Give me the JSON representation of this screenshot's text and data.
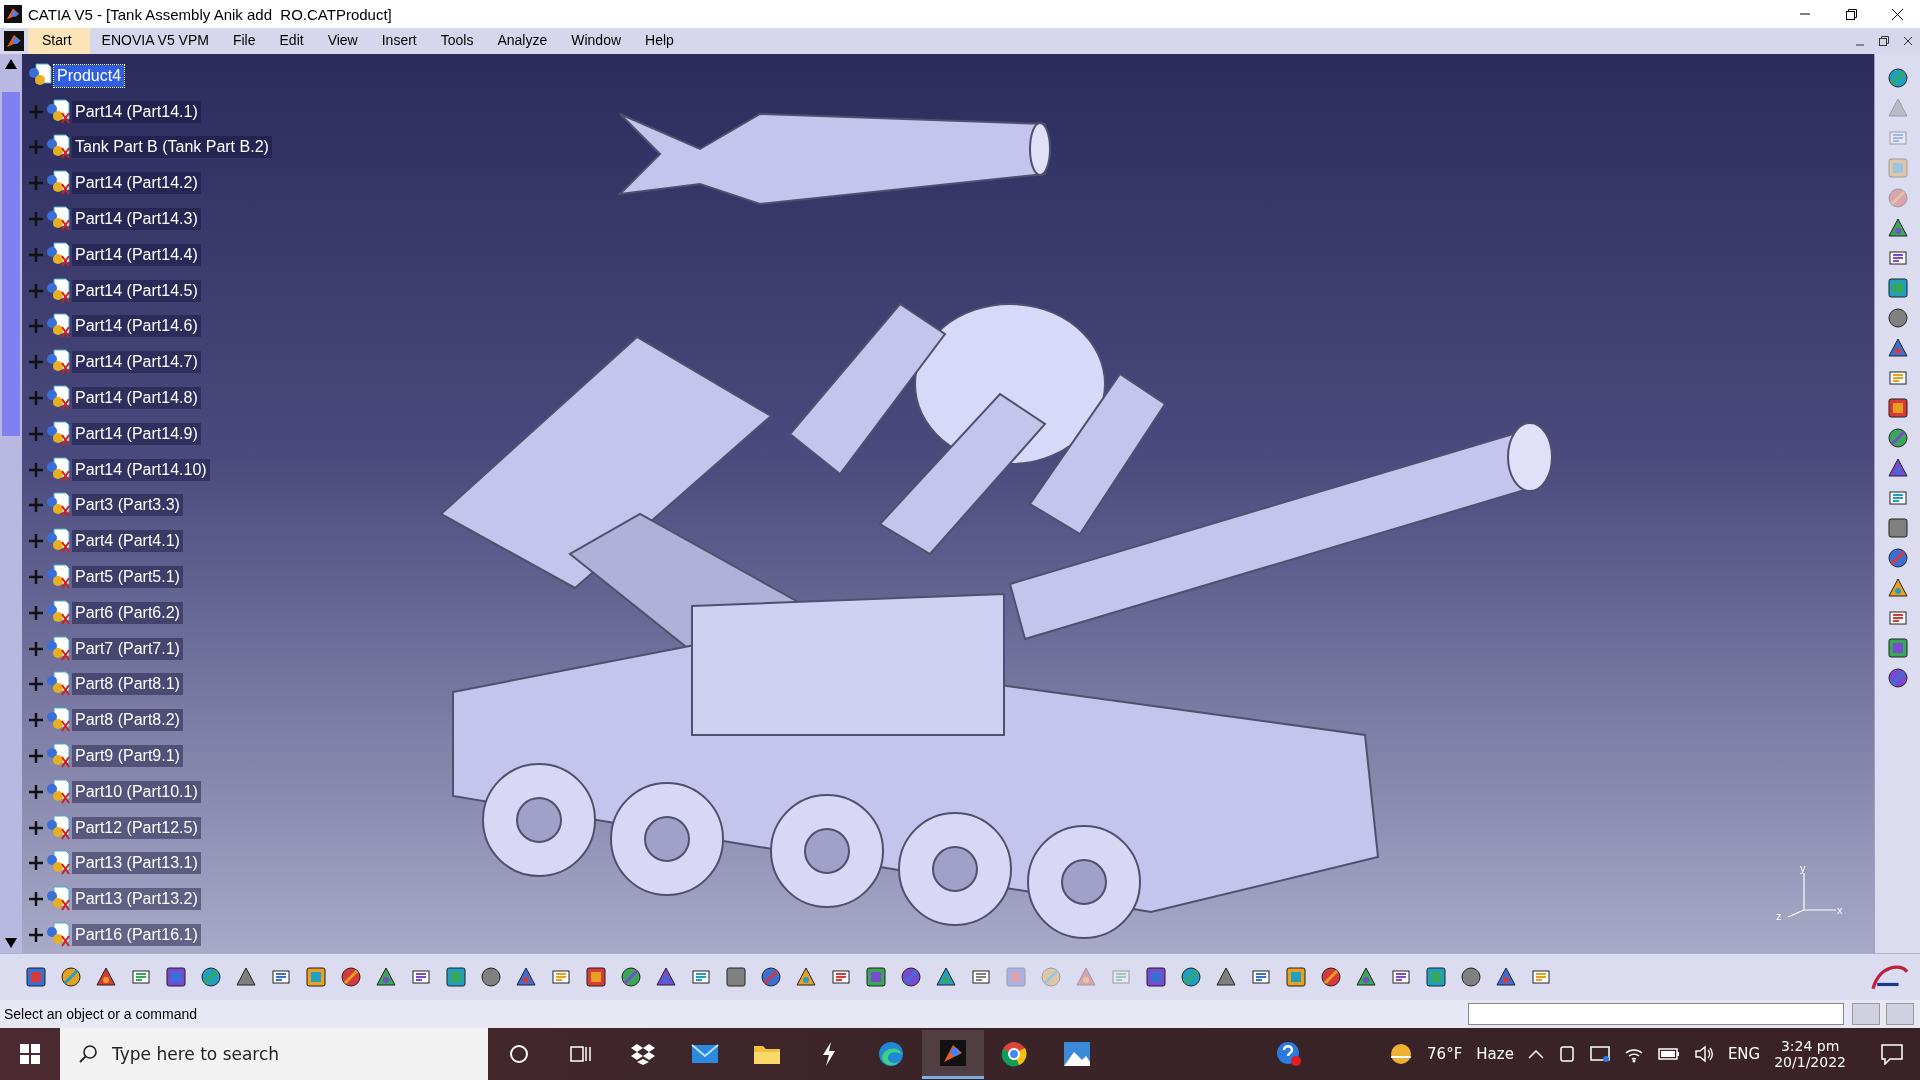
{
  "window": {
    "title": "CATIA V5 - [Tank Assembly Anik add  RO.CATProduct]"
  },
  "menu": [
    {
      "label": "Start",
      "selected": true
    },
    {
      "label": "ENOVIA V5 VPM",
      "selected": false
    },
    {
      "label": "File",
      "selected": false
    },
    {
      "label": "Edit",
      "selected": false
    },
    {
      "label": "View",
      "selected": false
    },
    {
      "label": "Insert",
      "selected": false
    },
    {
      "label": "Tools",
      "selected": false
    },
    {
      "label": "Analyze",
      "selected": false
    },
    {
      "label": "Window",
      "selected": false
    },
    {
      "label": "Help",
      "selected": false
    }
  ],
  "tree": {
    "root": {
      "label": "Product4",
      "selected": true,
      "children": [
        {
          "label": "Part14 (Part14.1)",
          "selected": false,
          "expanded": false
        },
        {
          "label": "Tank Part B (Tank Part B.2)",
          "selected": false,
          "expanded": false
        },
        {
          "label": "Part14 (Part14.2)",
          "selected": false,
          "expanded": false
        },
        {
          "label": "Part14 (Part14.3)",
          "selected": false,
          "expanded": false
        },
        {
          "label": "Part14 (Part14.4)",
          "selected": false,
          "expanded": false
        },
        {
          "label": "Part14 (Part14.5)",
          "selected": false,
          "expanded": false
        },
        {
          "label": "Part14 (Part14.6)",
          "selected": false,
          "expanded": false
        },
        {
          "label": "Part14 (Part14.7)",
          "selected": false,
          "expanded": false
        },
        {
          "label": "Part14 (Part14.8)",
          "selected": false,
          "expanded": false
        },
        {
          "label": "Part14 (Part14.9)",
          "selected": false,
          "expanded": false
        },
        {
          "label": "Part14 (Part14.10)",
          "selected": false,
          "expanded": false
        },
        {
          "label": "Part3 (Part3.3)",
          "selected": false,
          "expanded": false
        },
        {
          "label": "Part4 (Part4.1)",
          "selected": false,
          "expanded": false
        },
        {
          "label": "Part5 (Part5.1)",
          "selected": false,
          "expanded": false
        },
        {
          "label": "Part6 (Part6.2)",
          "selected": false,
          "expanded": false
        },
        {
          "label": "Part7 (Part7.1)",
          "selected": false,
          "expanded": false
        },
        {
          "label": "Part8 (Part8.1)",
          "selected": false,
          "expanded": false
        },
        {
          "label": "Part8 (Part8.2)",
          "selected": false,
          "expanded": false
        },
        {
          "label": "Part9 (Part9.1)",
          "selected": false,
          "expanded": false
        },
        {
          "label": "Part10 (Part10.1)",
          "selected": false,
          "expanded": false
        },
        {
          "label": "Part12 (Part12.5)",
          "selected": false,
          "expanded": false
        },
        {
          "label": "Part13 (Part13.1)",
          "selected": false,
          "expanded": false
        },
        {
          "label": "Part13 (Part13.2)",
          "selected": false,
          "expanded": false
        },
        {
          "label": "Part16 (Part16.1)",
          "selected": false,
          "expanded": false
        }
      ]
    }
  },
  "compass": {
    "labels": [
      "y",
      "z",
      "x"
    ]
  },
  "status_bar": {
    "message": "Select an object or a command"
  },
  "taskbar": {
    "search": {
      "placeholder": "Type here to search"
    },
    "weather": {
      "temperature": "76°F",
      "condition": "Haze"
    },
    "language": "ENG",
    "time": "3:24 pm",
    "date": "20/1/2022"
  }
}
